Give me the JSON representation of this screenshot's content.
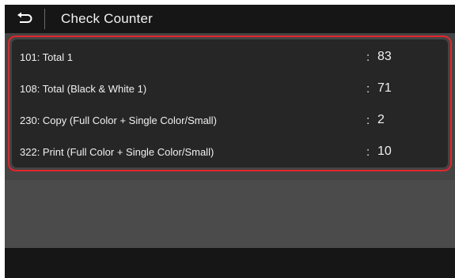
{
  "header": {
    "back_icon": "return-arrow-icon",
    "title": "Check Counter"
  },
  "counters": [
    {
      "label": "101: Total 1",
      "separator": ":",
      "value": "83"
    },
    {
      "label": "108: Total (Black & White 1)",
      "separator": ":",
      "value": "71"
    },
    {
      "label": "230: Copy (Full Color + Single Color/Small)",
      "separator": ":",
      "value": "2"
    },
    {
      "label": "322: Print (Full Color + Single Color/Small)",
      "separator": ":",
      "value": "10"
    }
  ],
  "colors": {
    "screen_background": "#444444",
    "header_background": "#161616",
    "list_background": "#262626",
    "highlight_border": "#e5242b",
    "text": "#f0f0f0"
  }
}
